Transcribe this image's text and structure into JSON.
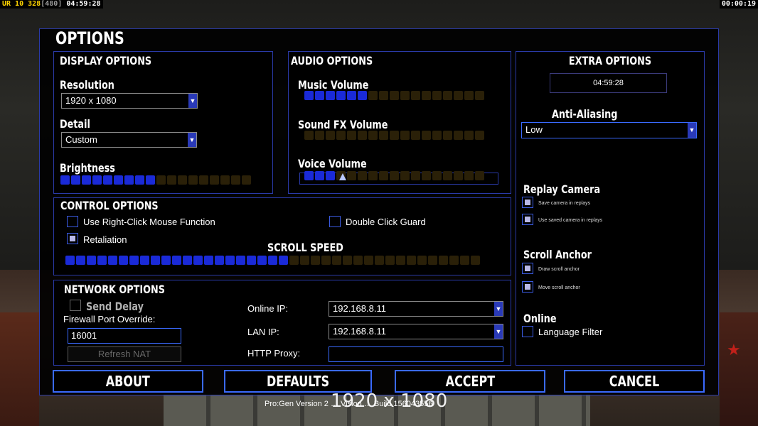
{
  "hud": {
    "left_a": "UR 10",
    "left_b": "328",
    "left_c": "[480]",
    "left_time": "04:59:28",
    "right_time": "00:00:19"
  },
  "footer": {
    "resolution_overlay": "1920 x 1080",
    "version_text": "Pro:Gen Version 2 … Vision … Build 156043556"
  },
  "title": "OPTIONS",
  "display": {
    "title": "DISPLAY OPTIONS",
    "resolution_label": "Resolution",
    "resolution_value": "1920 x 1080",
    "detail_label": "Detail",
    "detail_value": "Custom",
    "brightness_label": "Brightness",
    "brightness_level": 0.5
  },
  "audio": {
    "title": "AUDIO OPTIONS",
    "music_label": "Music Volume",
    "music_level": 0.35,
    "sfx_label": "Sound FX Volume",
    "sfx_level": 0,
    "voice_label": "Voice Volume",
    "voice_level": 0.15
  },
  "control": {
    "title": "CONTROL OPTIONS",
    "right_click_label": "Use Right-Click Mouse Function",
    "right_click_checked": false,
    "retaliation_label": "Retaliation",
    "retaliation_checked": true,
    "double_click_label": "Double Click Guard",
    "double_click_checked": false,
    "scroll_speed_label": "SCROLL SPEED",
    "scroll_speed_level": 0.55
  },
  "network": {
    "title": "NETWORK OPTIONS",
    "send_delay_label": "Send Delay",
    "firewall_label": "Firewall Port Override:",
    "firewall_value": "16001",
    "refresh_nat_label": "Refresh NAT",
    "online_ip_label": "Online IP:",
    "online_ip_value": "192.168.8.11",
    "lan_ip_label": "LAN IP:",
    "lan_ip_value": "192.168.8.11",
    "http_proxy_label": "HTTP Proxy:",
    "http_proxy_value": ""
  },
  "extra": {
    "title": "EXTRA OPTIONS",
    "clock": "04:59:28",
    "anti_aliasing_label": "Anti-Aliasing",
    "anti_aliasing_value": "Low",
    "replay_camera_label": "Replay Camera",
    "save_camera_label": "Save camera in replays",
    "use_saved_camera_label": "Use saved camera in replays",
    "scroll_anchor_label": "Scroll Anchor",
    "draw_scroll_anchor_label": "Draw scroll anchor",
    "move_scroll_anchor_label": "Move scroll anchor",
    "online_label": "Online",
    "language_filter_label": "Language Filter"
  },
  "buttons": {
    "about": "ABOUT",
    "defaults": "DEFAULTS",
    "accept": "ACCEPT",
    "cancel": "CANCEL"
  }
}
